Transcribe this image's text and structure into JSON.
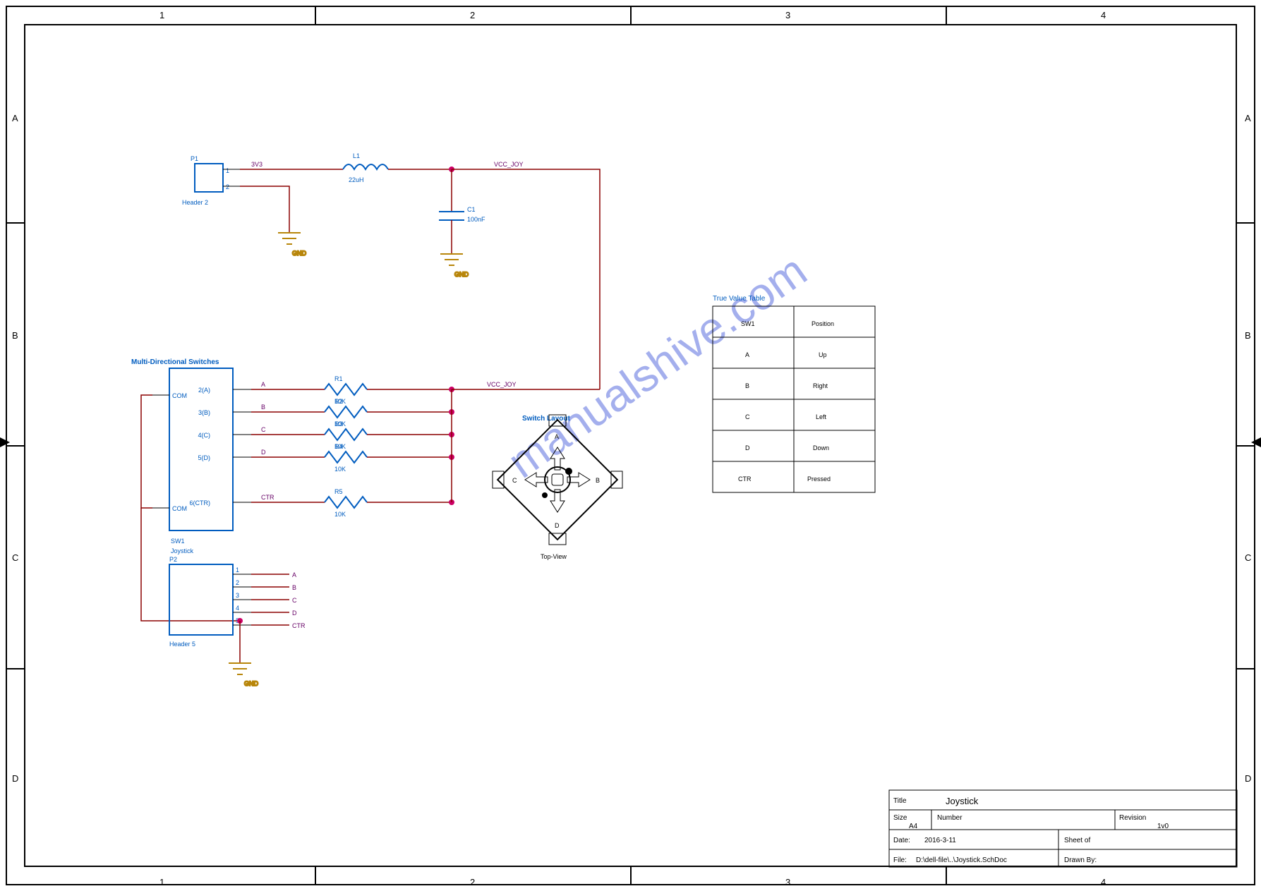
{
  "zones": {
    "cols": [
      "1",
      "2",
      "3",
      "4"
    ],
    "rows": [
      "A",
      "B",
      "C",
      "D"
    ]
  },
  "titleblock": {
    "title_label": "Title",
    "title": "Joystick",
    "size_label": "Size",
    "size": "A4",
    "number_label": "Number",
    "rev_label": "Revision",
    "rev": "1v0",
    "date_label": "Date:",
    "date": "2016-3-11",
    "sheet_label": "Sheet   of",
    "file_label": "File:",
    "file": "D:\\dell-file\\..\\Joystick.SchDoc",
    "drawn_label": "Drawn By:"
  },
  "power": {
    "conn": {
      "ref": "P1",
      "type": "Header 2",
      "pins": [
        "1",
        "2"
      ]
    },
    "net_in": "3V3",
    "net_out": "VCC_JOY",
    "gnd": "GND",
    "l": {
      "ref": "L1",
      "val": "22uH"
    },
    "c": {
      "ref": "C1",
      "val": "100nF"
    }
  },
  "switch": {
    "ref": "SW1",
    "title": "Multi-Directional Switches",
    "label": "Joystick",
    "pins": {
      "com": "COM",
      "a": "2(A)",
      "b": "3(B)",
      "c": "4(C)",
      "d": "5(D)",
      "ctr": "6(CTR)"
    },
    "nets": {
      "a": "A",
      "b": "B",
      "c": "C",
      "d": "D",
      "ctr": "CTR"
    }
  },
  "resistors": {
    "r1": {
      "ref": "R1",
      "val": "10K",
      "net": "A"
    },
    "r2": {
      "ref": "R2",
      "val": "10K",
      "net": "B"
    },
    "r3": {
      "ref": "R3",
      "val": "10K",
      "net": "C"
    },
    "r4": {
      "ref": "R4",
      "val": "10K",
      "net": "D"
    },
    "r5": {
      "ref": "R5",
      "val": "10K",
      "net": "CTR"
    }
  },
  "header": {
    "ref": "P2",
    "type": "Header 5",
    "pins": [
      "1",
      "2",
      "3",
      "4",
      "5"
    ],
    "nets": [
      "A",
      "B",
      "C",
      "D",
      "CTR"
    ]
  },
  "truth": {
    "title": "True Value Table",
    "cols": [
      "SW1",
      "Position"
    ],
    "rows": [
      [
        "A",
        "Up"
      ],
      [
        "B",
        "Right"
      ],
      [
        "C",
        "Left"
      ],
      [
        "D",
        "Down"
      ],
      [
        "CTR",
        "Pressed"
      ]
    ]
  },
  "fig": {
    "name": "Switch Layout",
    "top": "Top-View",
    "arrows": {
      "up": "A",
      "right": "B",
      "left": "C",
      "down": "D"
    }
  },
  "watermark": "manualshive.com"
}
